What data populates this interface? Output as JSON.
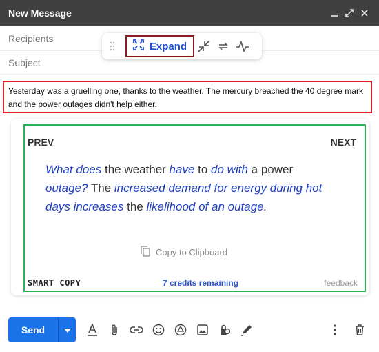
{
  "window": {
    "title": "New Message",
    "controls": [
      "minimize-icon",
      "popout-icon",
      "close-icon"
    ]
  },
  "header": {
    "recipients_label": "Recipients",
    "subject_label": "Subject"
  },
  "float_toolbar": {
    "expand_label": "Expand",
    "icons": [
      "drag-handle-icon",
      "expand-icon",
      "collapse-icon",
      "rephrase-icon",
      "pulse-icon"
    ]
  },
  "body": {
    "text": "Yesterday was a gruelling one, thanks to the weather. The mercury breached the 40 degree mark and the power outages didn't help either."
  },
  "smart_copy": {
    "prev_label": "PREV",
    "next_label": "NEXT",
    "suggestion": [
      {
        "text": "What does",
        "highlight": true
      },
      {
        "text": " the weather ",
        "highlight": false
      },
      {
        "text": "have",
        "highlight": true
      },
      {
        "text": " to ",
        "highlight": false
      },
      {
        "text": "do with",
        "highlight": true
      },
      {
        "text": " a power ",
        "highlight": false
      },
      {
        "text": "outage?",
        "highlight": true
      },
      {
        "text": " The ",
        "highlight": false
      },
      {
        "text": "increased demand for energy during hot days increases",
        "highlight": true
      },
      {
        "text": " the ",
        "highlight": false
      },
      {
        "text": "likelihood of an outage.",
        "highlight": true
      }
    ],
    "copy_label": "Copy to Clipboard",
    "brand_label": "SMART COPY",
    "credits_label": "7 credits remaining",
    "feedback_label": "feedback"
  },
  "bottom_toolbar": {
    "send_label": "Send",
    "tools": [
      "format-text-icon",
      "attach-icon",
      "link-icon",
      "emoji-icon",
      "drive-icon",
      "photo-icon",
      "confidential-icon",
      "signature-icon"
    ],
    "right": [
      "more-options-icon",
      "delete-icon"
    ]
  },
  "colors": {
    "titlebar": "#404040",
    "accent_blue": "#1a73e8",
    "expand_border": "#8b1a1a",
    "body_border": "#e2202b",
    "card_border": "#2bb24c",
    "highlight_text": "#1f3fbf"
  }
}
